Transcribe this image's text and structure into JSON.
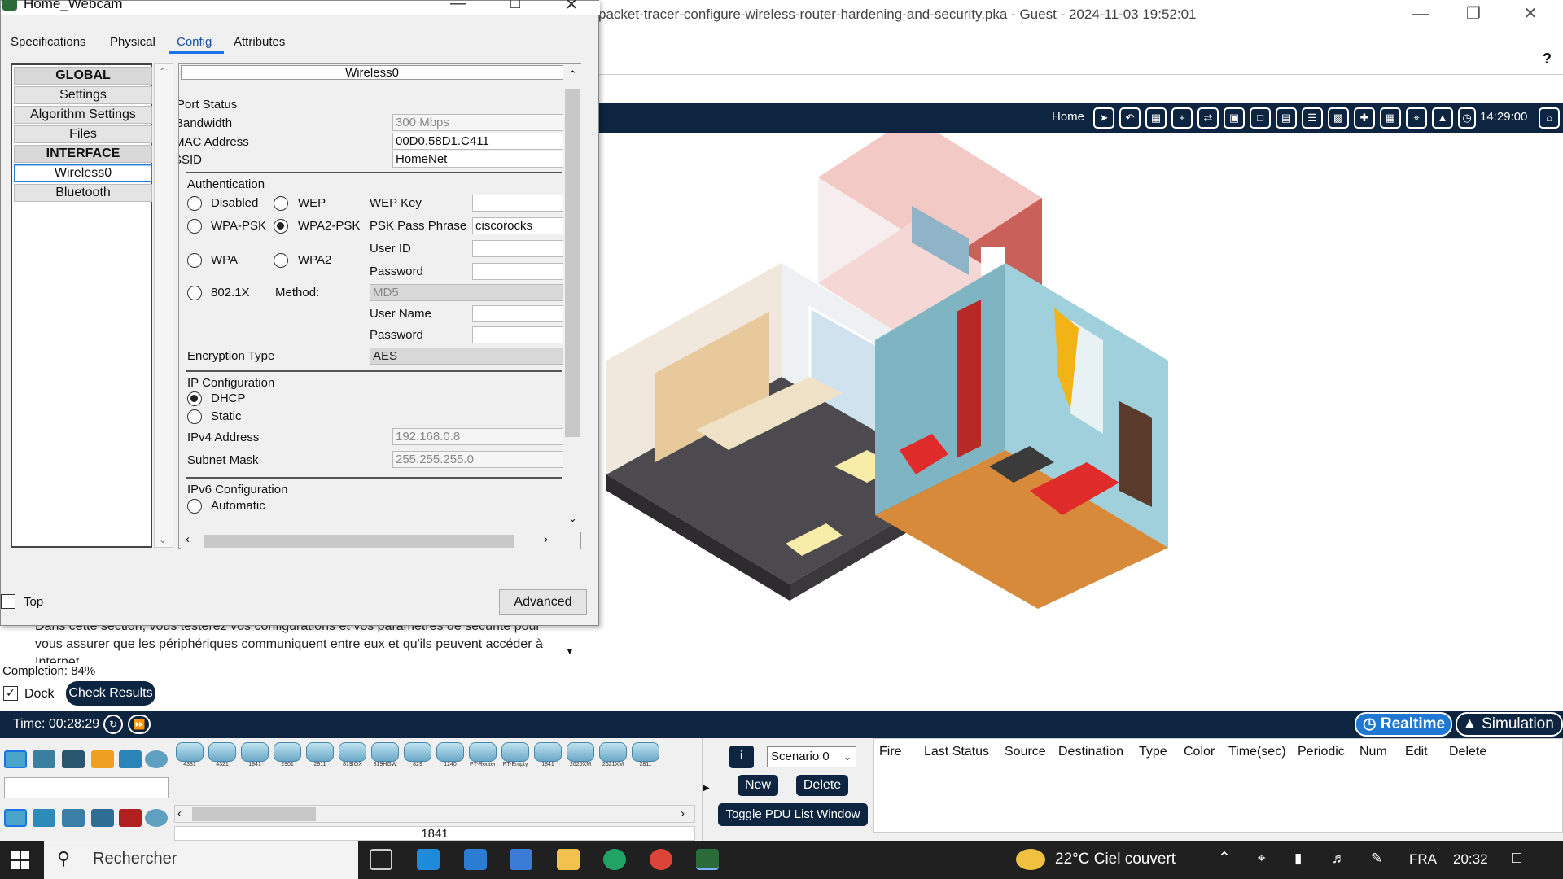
{
  "main_window": {
    "title": "packet-tracer-configure-wireless-router-hardening-and-security.pka - Guest - 2024-11-03 19:52:01",
    "help": "?",
    "nav": {
      "home_label": "Home",
      "clock": "14:29:00"
    }
  },
  "dialog": {
    "title": "Home_Webcam",
    "tabs": [
      "Specifications",
      "Physical",
      "Config",
      "Attributes"
    ],
    "active_tab": "Config",
    "left_list": [
      "GLOBAL",
      "Settings",
      "Algorithm Settings",
      "Files",
      "INTERFACE",
      "Wireless0",
      "Bluetooth"
    ],
    "selected_item": "Wireless0",
    "panel_header": "Wireless0",
    "port_status_label": "Port Status",
    "bandwidth_label": "Bandwidth",
    "bandwidth_value": "300 Mbps",
    "mac_label": "MAC Address",
    "mac_value": "00D0.58D1.C411",
    "ssid_label": "SSID",
    "ssid_value": "HomeNet",
    "auth": {
      "title": "Authentication",
      "options": [
        "Disabled",
        "WEP",
        "WPA-PSK",
        "WPA2-PSK",
        "WPA",
        "WPA2",
        "802.1X"
      ],
      "selected": "WPA2-PSK",
      "wep_key_label": "WEP Key",
      "wep_key_value": "",
      "psk_label": "PSK Pass Phrase",
      "psk_value": "ciscorocks",
      "user_id_label": "User ID",
      "password_label": "Password",
      "method_label": "Method:",
      "method_value": "MD5",
      "user_name_label": "User Name",
      "password2_label": "Password"
    },
    "encryption_label": "Encryption Type",
    "encryption_value": "AES",
    "ip": {
      "title": "IP Configuration",
      "dhcp_label": "DHCP",
      "static_label": "Static",
      "selected": "DHCP",
      "ipv4_label": "IPv4 Address",
      "ipv4_value": "192.168.0.8",
      "mask_label": "Subnet Mask",
      "mask_value": "255.255.255.0"
    },
    "ipv6": {
      "title": "IPv6 Configuration",
      "auto_label": "Automatic"
    },
    "top_label": "Top",
    "advanced_label": "Advanced"
  },
  "instructions": {
    "text": "Dans cette section, vous testerez vos configurations et vos paramètres de sécurité pour vous assurer que les périphériques communiquent entre eux et qu'ils peuvent accéder à Internet",
    "completion": "Completion: 84%",
    "dock_label": "Dock",
    "check_results": "Check Results"
  },
  "timebar": {
    "time": "Time: 00:28:29",
    "realtime": "Realtime",
    "simulation": "Simulation"
  },
  "devices": [
    "4331",
    "4321",
    "1941",
    "2901",
    "2911",
    "819IOX",
    "819HGW",
    "829",
    "1240",
    "PT-Router",
    "PT-Empty",
    "1841",
    "2620XM",
    "2621XM",
    "2811"
  ],
  "device_label": "1841",
  "scenario": {
    "selected": "Scenario 0",
    "new": "New",
    "delete": "Delete",
    "toggle": "Toggle PDU List Window"
  },
  "pdu_columns": [
    "Fire",
    "Last Status",
    "Source",
    "Destination",
    "Type",
    "Color",
    "Time(sec)",
    "Periodic",
    "Num",
    "Edit",
    "Delete"
  ],
  "taskbar": {
    "search": "Rechercher",
    "weather": "22°C  Ciel couvert",
    "lang": "FRA",
    "time": "20:32"
  },
  "colors": {
    "navy": "#0d2540",
    "accent": "#1f78d1"
  }
}
